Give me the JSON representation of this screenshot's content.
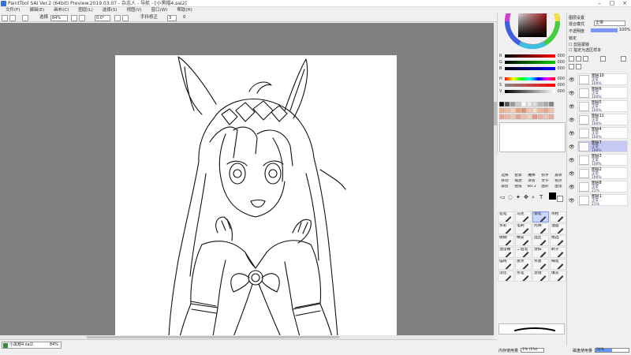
{
  "window": {
    "title": "PaintTool SAI Ver.2 (64bit) Preview.2019.03.07 - 杂志人 - 导航 - [小黑帽4.sai2]"
  },
  "menu": [
    "文件(F)",
    "编辑(E)",
    "画布(C)",
    "图层(L)",
    "选择(S)",
    "视图(V)",
    "窗口(W)",
    "帮助(H)"
  ],
  "toolbar": {
    "select_label": "选择",
    "zoom": "84%",
    "angle": "0.0°",
    "stabilizer_label": "手抖修正",
    "stabilizer_value": "3",
    "zero_label": "0"
  },
  "status": {
    "file_name": "小黑帽4.sai2",
    "zoom": "84%",
    "memory_label": "内存使用量",
    "memory_value": "1% (1%)",
    "disk_label": "磁盘使用量",
    "disk_value": "50%"
  },
  "color": {
    "main_color": "#c01818",
    "sub_color": "#ffffff",
    "rgb_labels": [
      "R",
      "G",
      "B"
    ],
    "rgb_values": [
      "000",
      "000",
      "000"
    ],
    "hsv_labels": [
      "H",
      "S",
      "V"
    ],
    "hsv_values": [
      "000",
      "000",
      "000"
    ]
  },
  "tools": {
    "top_items": [
      "选择",
      "套索",
      "魔棒",
      "抓手",
      "旋转",
      "移动",
      "缩放",
      "滴管",
      "文字",
      "视点",
      "裁剪",
      "贴纸",
      "Ver.3",
      "图形",
      "图笔"
    ],
    "brushes": [
      {
        "label": "铅笔",
        "sel": false
      },
      {
        "label": "马克",
        "sel": false
      },
      {
        "label": "钢笔",
        "sel": true
      },
      {
        "label": "喷枪",
        "sel": false
      },
      {
        "label": "水彩",
        "sel": false
      },
      {
        "label": "笔刷",
        "sel": false
      },
      {
        "label": "丙烯",
        "sel": false
      },
      {
        "label": "油画",
        "sel": false
      },
      {
        "label": "模糊",
        "sel": false
      },
      {
        "label": "橡皮",
        "sel": false
      },
      {
        "label": "选区",
        "sel": false
      },
      {
        "label": "擦选",
        "sel": false
      },
      {
        "label": "油漆桶",
        "sel": false
      },
      {
        "label": "二值笔",
        "sel": false
      },
      {
        "label": "涂抹",
        "sel": false
      },
      {
        "label": "刷子",
        "sel": false
      },
      {
        "label": "描线",
        "sel": false
      },
      {
        "label": "墨水",
        "sel": false
      },
      {
        "label": "水墨",
        "sel": false
      },
      {
        "label": "细笔",
        "sel": false
      },
      {
        "label": "淡化",
        "sel": false
      },
      {
        "label": "水笔",
        "sel": false
      },
      {
        "label": "滤镜",
        "sel": false
      },
      {
        "label": "填充",
        "sel": false
      }
    ]
  },
  "layers": {
    "header_title": "图层设置",
    "blend_label": "混合模式",
    "blend_value": "正常",
    "opacity_label": "不透明度",
    "opacity_value": "100%",
    "lock_label": "锁定",
    "clip_label": "剪贴蒙版",
    "ref_label": "指定为选区样本",
    "items": [
      {
        "name": "图层10",
        "mode": "正常",
        "opacity": "100%",
        "sel": false
      },
      {
        "name": "图层6",
        "mode": "正常",
        "opacity": "100%",
        "sel": false
      },
      {
        "name": "图层5",
        "mode": "正常",
        "opacity": "100%",
        "sel": false
      },
      {
        "name": "图层11",
        "mode": "正常",
        "opacity": "100%",
        "sel": false
      },
      {
        "name": "图层4",
        "mode": "正常",
        "opacity": "100%",
        "sel": false
      },
      {
        "name": "图层7",
        "mode": "正常",
        "opacity": "100%",
        "sel": true
      },
      {
        "name": "图层3",
        "mode": "正常",
        "opacity": "100%",
        "sel": false
      },
      {
        "name": "图层2",
        "mode": "正常",
        "opacity": "100%",
        "sel": false
      },
      {
        "name": "图层8",
        "mode": "正常",
        "opacity": "21%",
        "sel": false
      },
      {
        "name": "图层1",
        "mode": "正常",
        "opacity": "21%",
        "sel": false
      }
    ]
  }
}
